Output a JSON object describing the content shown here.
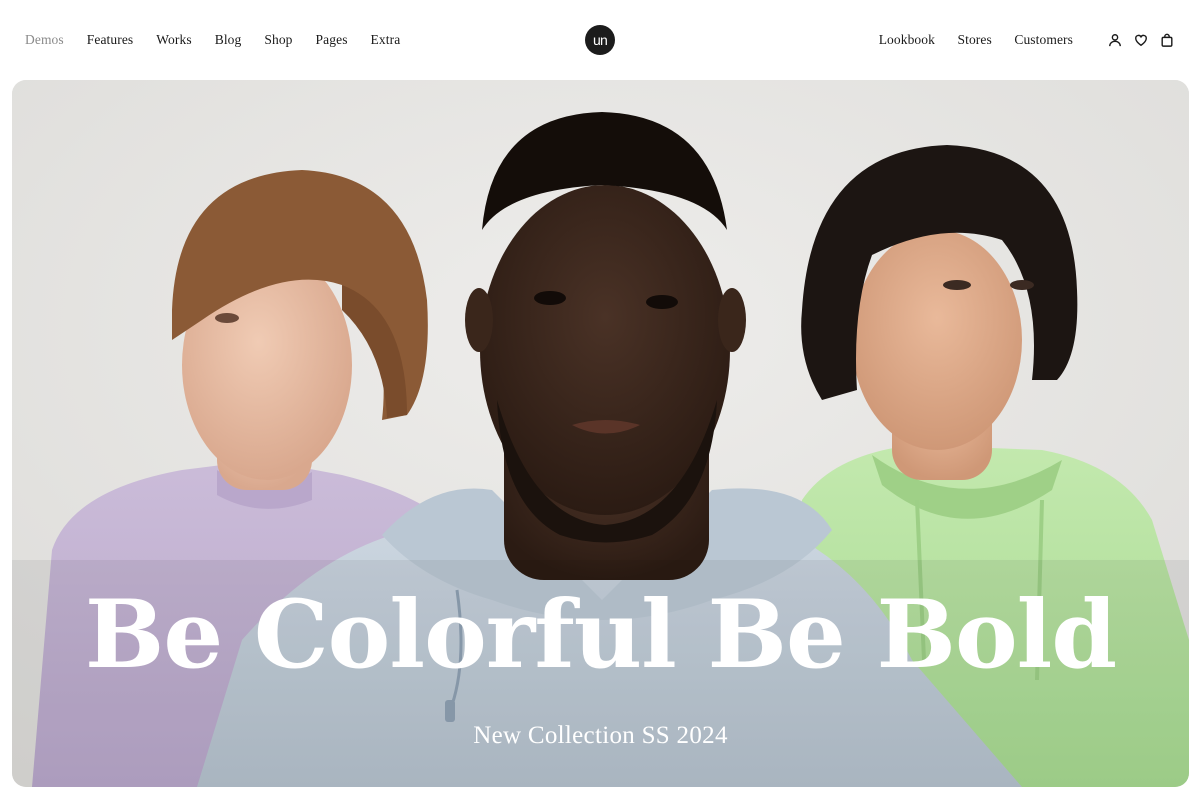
{
  "header": {
    "nav_left": [
      {
        "label": "Demos",
        "active": false
      },
      {
        "label": "Features"
      },
      {
        "label": "Works"
      },
      {
        "label": "Blog"
      },
      {
        "label": "Shop"
      },
      {
        "label": "Pages"
      },
      {
        "label": "Extra"
      }
    ],
    "logo": "un",
    "nav_right": [
      {
        "label": "Lookbook"
      },
      {
        "label": "Stores"
      },
      {
        "label": "Customers"
      }
    ],
    "icons": [
      "user-icon",
      "heart-icon",
      "bag-icon"
    ]
  },
  "hero": {
    "title": "Be Colorful Be Bold",
    "subtitle": "New Collection SS 2024"
  },
  "colors": {
    "text": "#1a1a1a",
    "muted": "#8a8a8a",
    "hero_text": "#ffffff",
    "backdrop": "#e6e5e3",
    "lavender": "#c6b6d6",
    "light_blue": "#c7d2dc",
    "mint_green": "#b8e3a4"
  }
}
